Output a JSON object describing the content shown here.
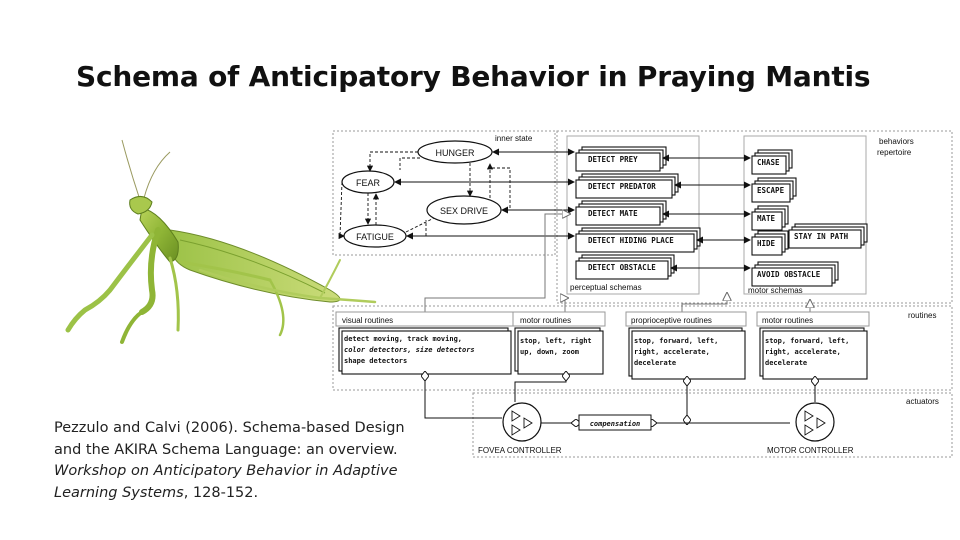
{
  "slide": {
    "title": "Schema of Anticipatory Behavior in Praying Mantis"
  },
  "citation": {
    "line1": "Pezzulo and Calvi (2006). Schema-based Design",
    "line2": "and the AKIRA Schema Language: an overview.",
    "line3": "Workshop on Anticipatory Behavior in Adaptive",
    "line4a": "Learning Systems",
    "line4b": ", 128-152."
  },
  "diagram": {
    "regions": {
      "inner_state": "inner state",
      "behaviors_repertoire_1": "behaviors",
      "behaviors_repertoire_2": "repertoire",
      "perceptual_schemas": "perceptual schemas",
      "motor_schemas": "motor schemas",
      "routines": "routines",
      "actuators": "actuators"
    },
    "inner_states": [
      "HUNGER",
      "FEAR",
      "SEX DRIVE",
      "FATIGUE"
    ],
    "perceptual": [
      "DETECT PREY",
      "DETECT PREDATOR",
      "DETECT MATE",
      "DETECT HIDING PLACE",
      "DETECT OBSTACLE"
    ],
    "motor": [
      "CHASE",
      "ESCAPE",
      "MATE",
      "HIDE",
      "STAY IN PATH",
      "AVOID OBSTACLE"
    ],
    "routine_groups": [
      {
        "title": "visual routines",
        "lines": [
          "detect moving, track moving,",
          "color detectors, size detectors",
          "shape detectors"
        ]
      },
      {
        "title": "motor routines",
        "lines": [
          "stop, left, right",
          "up, down, zoom"
        ]
      },
      {
        "title": "proprioceptive routines",
        "lines": [
          "stop, forward, left,",
          "right, accelerate,",
          "decelerate"
        ]
      },
      {
        "title": "motor routines",
        "lines": [
          "stop, forward, left,",
          "right, accelerate,",
          "decelerate"
        ]
      }
    ],
    "actuators": {
      "left": "FOVEA CONTROLLER",
      "right": "MOTOR CONTROLLER",
      "link": "compensation"
    }
  }
}
